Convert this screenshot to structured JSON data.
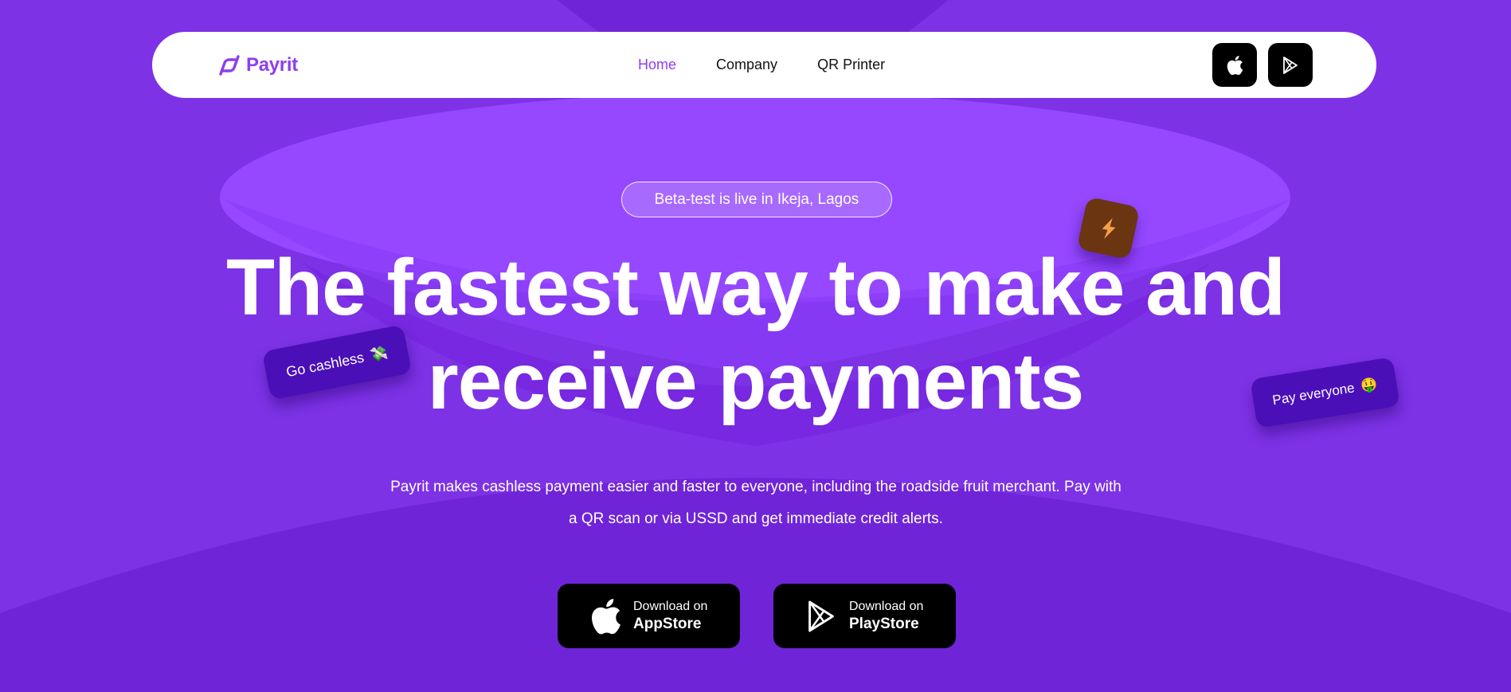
{
  "colors": {
    "background": "#7d32e6",
    "accent": "#8e3df0",
    "tag_background": "#4b0fb8",
    "bolt_tile": "#6a3510"
  },
  "navbar": {
    "logo_text": "Payrit",
    "links": [
      {
        "label": "Home",
        "active": true
      },
      {
        "label": "Company",
        "active": false
      },
      {
        "label": "QR Printer",
        "active": false
      }
    ],
    "store_icons": [
      "apple-icon",
      "play-store-icon"
    ]
  },
  "hero": {
    "beta_label": "Beta-test is live in Ikeja, Lagos",
    "headline_line1": "The fastest way to make and",
    "headline_line2": "receive payments",
    "subtext_line1": "Payrit makes cashless payment easier and faster to everyone, including the roadside fruit merchant. Pay with",
    "subtext_line2": "a QR scan or via USSD and get immediate credit alerts."
  },
  "floating_tags": {
    "cashless_label": "Go cashless",
    "cashless_emoji": "💸",
    "pay_label": "Pay everyone",
    "pay_emoji": "🤑",
    "bolt_icon": "lightning-bolt-icon"
  },
  "downloads": {
    "appstore": {
      "small": "Download on",
      "big": "AppStore"
    },
    "playstore": {
      "small": "Download on",
      "big": "PlayStore"
    }
  }
}
